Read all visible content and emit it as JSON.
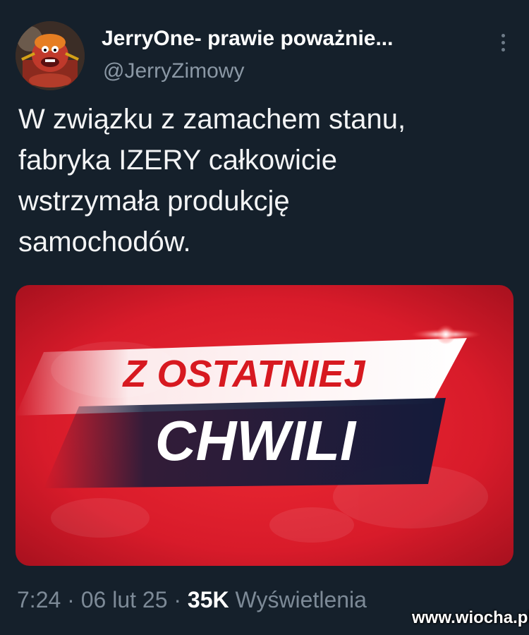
{
  "author": {
    "display_name": "JerryOne- prawie poważnie...",
    "handle": "@JerryZimowy"
  },
  "tweet": {
    "text_lines": [
      "W związku z zamachem stanu,",
      "fabryka IZERY całkowicie",
      "wstrzymała produkcję",
      "samochodów."
    ]
  },
  "media": {
    "headline_top": "Z OSTATNIEJ",
    "headline_bottom": "CHWILI",
    "colors": {
      "background": "#d81b2a",
      "band_light": "#ffffff",
      "band_dark": "#141b3a",
      "text_red": "#d71920"
    }
  },
  "meta": {
    "time": "7:24",
    "sep1": " · ",
    "date": "06 lut 25",
    "sep2": " · ",
    "views_count": "35K",
    "views_label": " Wyświetlenia"
  },
  "watermark": "www.wiocha.pl",
  "icons": {
    "avatar": "avatar-image",
    "more": "more-vertical-icon"
  }
}
